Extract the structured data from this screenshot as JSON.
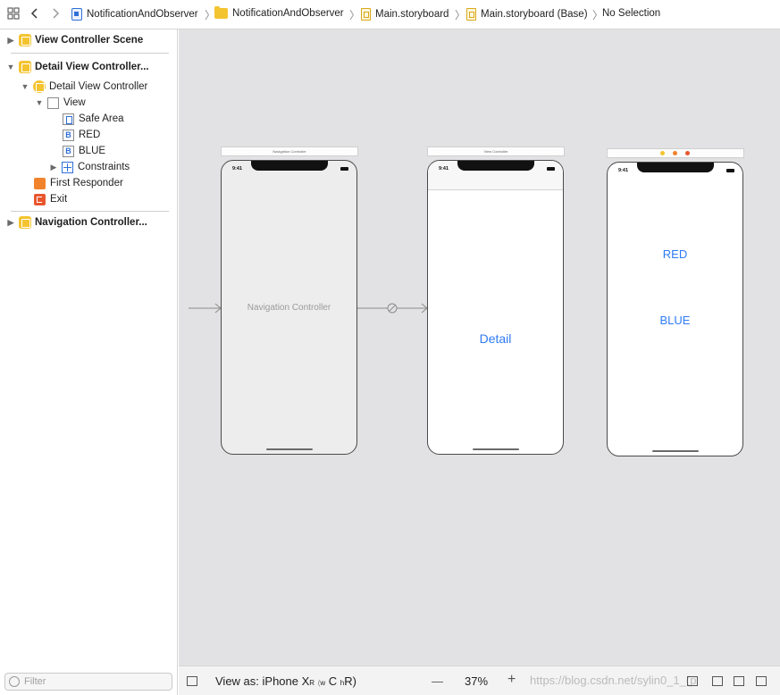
{
  "jumpbar": {
    "grid_icon": "related-items-grid-icon",
    "crumbs": [
      {
        "label": "NotificationAndObserver",
        "icon": "project-icon"
      },
      {
        "label": "NotificationAndObserver",
        "icon": "folder-icon"
      },
      {
        "label": "Main.storyboard",
        "icon": "storyboard-icon"
      },
      {
        "label": "Main.storyboard (Base)",
        "icon": "storyboard-icon"
      },
      {
        "label": "No Selection",
        "icon": ""
      }
    ]
  },
  "outline": {
    "items": [
      {
        "label": "View Controller Scene",
        "level": 0,
        "expanded": false
      },
      {
        "label": "Detail View Controller...",
        "level": 0,
        "expanded": true
      },
      {
        "label": "Detail View Controller",
        "level": 1,
        "expanded": true
      },
      {
        "label": "View",
        "level": 2,
        "expanded": true
      },
      {
        "label": "Safe Area",
        "level": 3
      },
      {
        "label": "RED",
        "level": 3
      },
      {
        "label": "BLUE",
        "level": 3
      },
      {
        "label": "Constraints",
        "level": 3,
        "expanded": false
      },
      {
        "label": "First Responder",
        "level": 1
      },
      {
        "label": "Exit",
        "level": 1
      },
      {
        "label": "Navigation Controller...",
        "level": 0,
        "expanded": false
      }
    ],
    "filter_placeholder": "Filter"
  },
  "canvas": {
    "scenes": [
      {
        "title": "Navigation Controller",
        "time": "9:41",
        "label": "Navigation Controller"
      },
      {
        "title": "View Controller",
        "time": "9:41",
        "label": "Detail"
      },
      {
        "title": "",
        "time": "9:41",
        "buttons": [
          "RED",
          "BLUE"
        ]
      }
    ],
    "colors": {
      "background": "#e2e2e4",
      "link": "#2f7bf5",
      "nav_label": "#9a9a9a"
    }
  },
  "bottombar": {
    "view_as": "View as: iPhone X",
    "view_as_suffix_r": "R",
    "size_class_w": "w",
    "size_class_c": "C",
    "size_class_h": "h",
    "size_class_r": "R",
    "zoom_out": "—",
    "zoom": "37%",
    "zoom_in": "+",
    "watermark": "https://blog.csdn.net/sylin0_1_(p"
  }
}
